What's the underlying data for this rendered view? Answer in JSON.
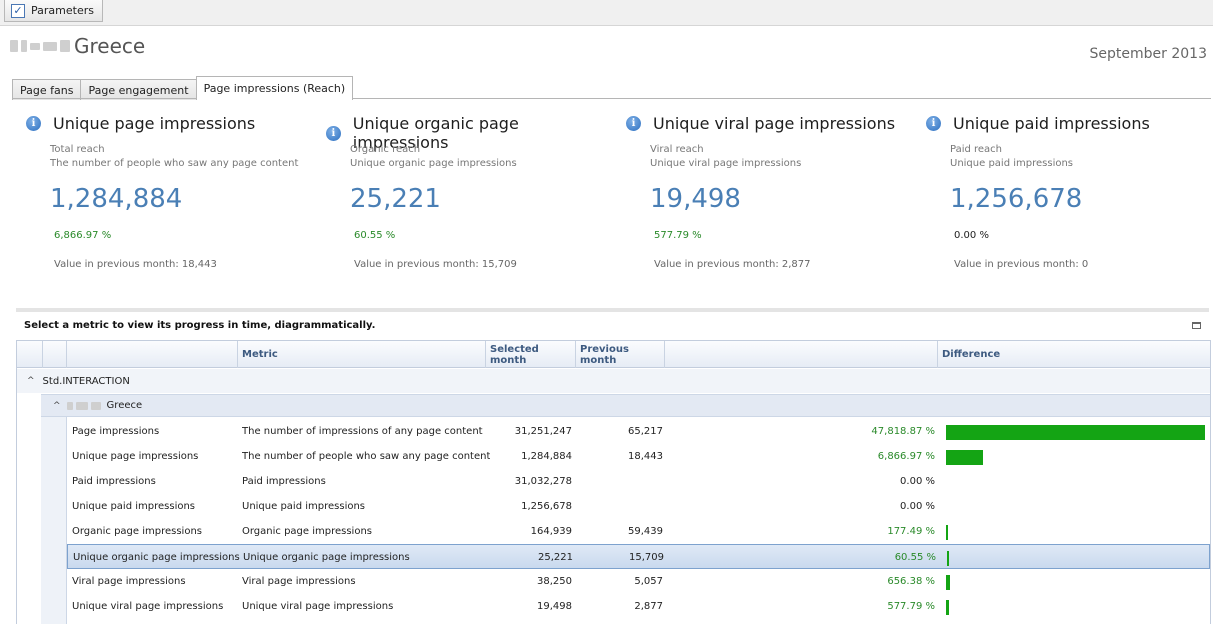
{
  "toolbar": {
    "parameters_label": "Parameters",
    "check_mark": "✓"
  },
  "header": {
    "entity": "Greece",
    "month": "September 2013"
  },
  "tabs": [
    {
      "label": "Page fans",
      "active": false
    },
    {
      "label": "Page engagement",
      "active": false
    },
    {
      "label": "Page impressions (Reach)",
      "active": true
    }
  ],
  "kpis": [
    {
      "title": "Unique page impressions",
      "sub1": "Total reach",
      "sub2": "The number of people who saw any page content",
      "value": "1,284,884",
      "pct": "6,866.97 %",
      "prev": "Value in previous month: 18,443",
      "trend": "up"
    },
    {
      "title": "Unique organic page impressions",
      "sub1": "Organic reach",
      "sub2": "Unique organic page impressions",
      "value": "25,221",
      "pct": "60.55 %",
      "prev": "Value in previous month: 15,709",
      "trend": "up"
    },
    {
      "title": "Unique viral page impressions",
      "sub1": "Viral reach",
      "sub2": "Unique viral page impressions",
      "value": "19,498",
      "pct": "577.79 %",
      "prev": "Value in previous month: 2,877",
      "trend": "up"
    },
    {
      "title": "Unique paid impressions",
      "sub1": "Paid reach",
      "sub2": "Unique paid impressions",
      "value": "1,256,678",
      "pct": "0.00 %",
      "prev": "Value in previous month: 0",
      "trend": "neutral"
    }
  ],
  "instructions": "Select a metric to view its progress in time, diagrammatically.",
  "grid": {
    "columns": {
      "metric": "Metric",
      "selected": "Selected month",
      "previous": "Previous month",
      "difference": "Difference"
    },
    "group1": "Std.INTERACTION",
    "group2": "Greece",
    "rows": [
      {
        "name": "Page impressions",
        "desc": "The number of impressions of any page content",
        "selected": "31,251,247",
        "previous": "65,217",
        "pct": "47,818.87 %",
        "trend": "up",
        "bar_fraction": 1.0
      },
      {
        "name": "Unique page impressions",
        "desc": "The number of people who saw any page content",
        "selected": "1,284,884",
        "previous": "18,443",
        "pct": "6,866.97 %",
        "trend": "up",
        "bar_fraction": 0.1436
      },
      {
        "name": "Paid impressions",
        "desc": "Paid impressions",
        "selected": "31,032,278",
        "previous": "",
        "pct": "0.00 %",
        "trend": "neutral",
        "bar_fraction": 0
      },
      {
        "name": "Unique paid impressions",
        "desc": "Unique paid impressions",
        "selected": "1,256,678",
        "previous": "",
        "pct": "0.00 %",
        "trend": "neutral",
        "bar_fraction": 0
      },
      {
        "name": "Organic page impressions",
        "desc": "Organic page impressions",
        "selected": "164,939",
        "previous": "59,439",
        "pct": "177.49 %",
        "trend": "up",
        "bar_fraction": 0.0037
      },
      {
        "name": "Unique organic page impressions",
        "desc": "Unique organic page impressions",
        "selected": "25,221",
        "previous": "15,709",
        "pct": "60.55 %",
        "trend": "up",
        "bar_fraction": 0.0013,
        "selected_row": true
      },
      {
        "name": "Viral page impressions",
        "desc": "Viral page impressions",
        "selected": "38,250",
        "previous": "5,057",
        "pct": "656.38 %",
        "trend": "up",
        "bar_fraction": 0.0137
      },
      {
        "name": "Unique viral page impressions",
        "desc": "Unique viral page impressions",
        "selected": "19,498",
        "previous": "2,877",
        "pct": "577.79 %",
        "trend": "up",
        "bar_fraction": 0.0121
      }
    ]
  },
  "colors": {
    "accent_value": "#4a7fb5",
    "positive": "#2a8a2a",
    "bar": "#14a414"
  }
}
